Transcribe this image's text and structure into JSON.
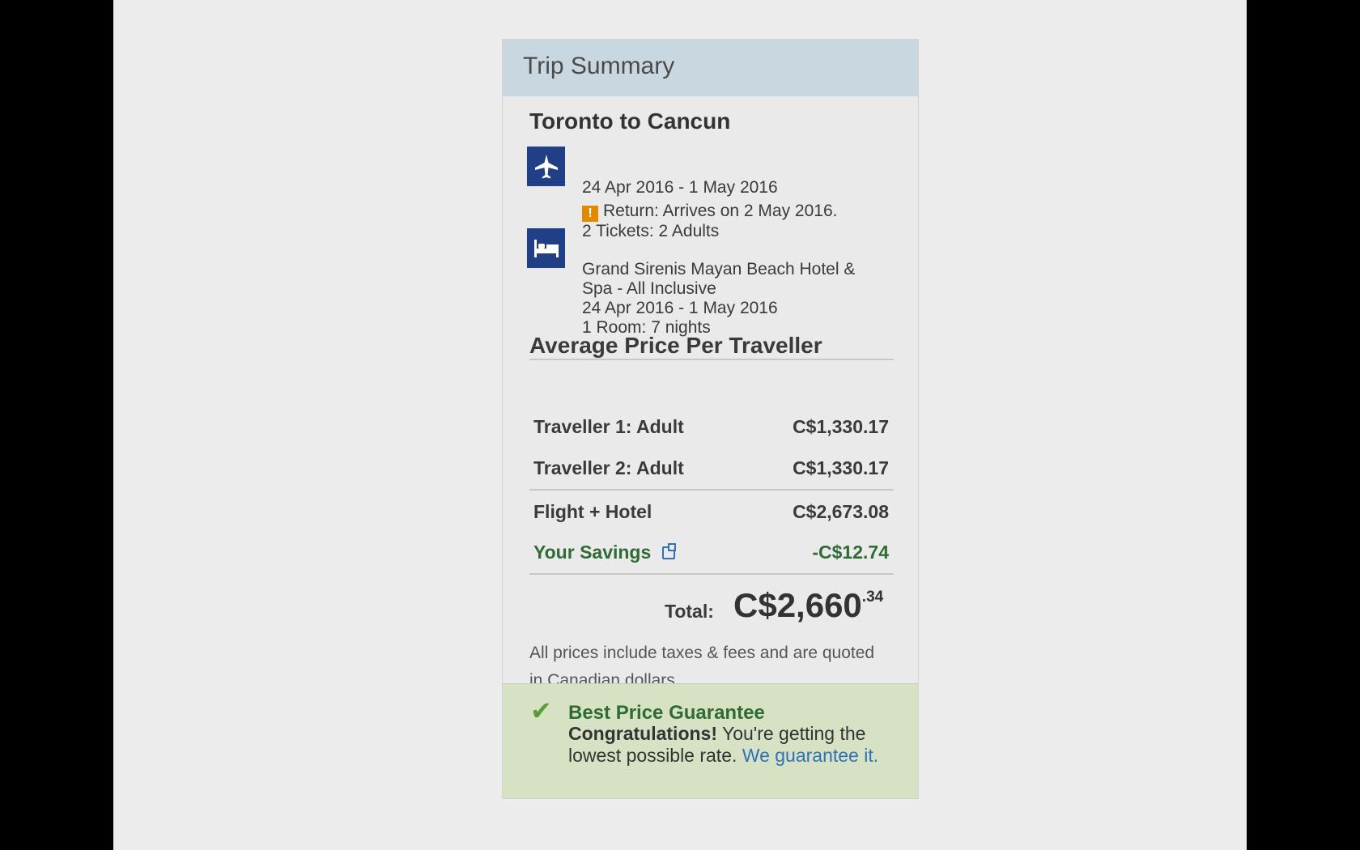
{
  "trip_summary": {
    "title": "Trip Summary",
    "route": "Toronto to Cancun",
    "flight": {
      "dates": "24 Apr 2016 - 1 May 2016",
      "warning": "Return: Arrives on 2 May 2016.",
      "tickets": "2 Tickets: 2 Adults",
      "icon": "airplane-icon"
    },
    "hotel": {
      "name_line1": "Grand Sirenis Mayan Beach Hotel &",
      "name_line2": "Spa - All Inclusive",
      "dates": "24 Apr 2016 - 1 May 2016",
      "rooms": "1 Room: 7 nights",
      "icon": "bed-icon"
    }
  },
  "pricing": {
    "section_title": "Average Price Per Traveller",
    "travellers": [
      {
        "label": "Traveller 1: Adult",
        "value": "C$1,330.17"
      },
      {
        "label": "Traveller 2: Adult",
        "value": "C$1,330.17"
      }
    ],
    "flight_hotel_label": "Flight + Hotel",
    "flight_hotel_value": "C$2,673.08",
    "savings_label": "Your Savings",
    "savings_value": "-C$12.74",
    "total_label": "Total:",
    "total_main": "C$2,660",
    "total_cents": ".34",
    "disclaimer": "All prices include taxes & fees and are quoted in Canadian dollars"
  },
  "guarantee": {
    "title": "Best Price Guarantee",
    "strong": "Congratulations!",
    "text": "You're getting the lowest possible rate.",
    "link": "We guarantee it."
  },
  "colors": {
    "header": "#c9d7e0",
    "icon_blue": "#213f86",
    "savings_green": "#2f6b35",
    "guarantee_bg": "#d7e2c4",
    "warning_orange": "#e08a00"
  }
}
